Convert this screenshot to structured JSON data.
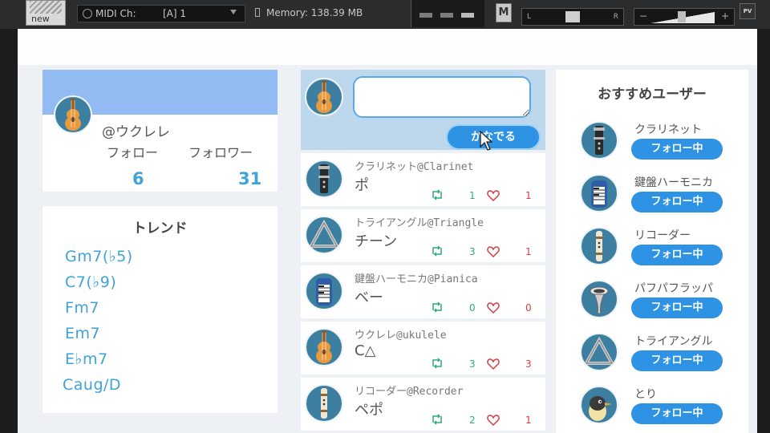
{
  "host": {
    "logo_text": "new",
    "midi_label": "MIDI Ch:",
    "midi_value": "[A] 1",
    "memory": "Memory: 138.39 MB",
    "mute_label": "M",
    "pan_left": "L",
    "pan_right": "R",
    "vol_minus": "−",
    "vol_plus": "+",
    "pv_label": "PV"
  },
  "profile": {
    "handle": "@ウクレレ",
    "follow_label": "フォロー",
    "follower_label": "フォロワー",
    "follow_count": "6",
    "follower_count": "31",
    "avatar_icon": "ukulele-icon",
    "banner_color": "#92baf3"
  },
  "trend": {
    "title": "トレンド",
    "items": [
      "Gm7(♭5)",
      "C7(♭9)",
      "Fm7",
      "Em7",
      "E♭m7",
      "Caug/D"
    ]
  },
  "compose": {
    "placeholder": "",
    "send_label": "かなでる",
    "avatar_icon": "ukulele-icon"
  },
  "posts": [
    {
      "author": "クラリネット@Clarinet",
      "body": "ポ",
      "retweets": "1",
      "likes": "1",
      "icon": "clarinet-icon"
    },
    {
      "author": "トライアングル@Triangle",
      "body": "チーン",
      "retweets": "3",
      "likes": "1",
      "icon": "triangle-icon"
    },
    {
      "author": "鍵盤ハーモニカ@Pianica",
      "body": "ベー",
      "retweets": "0",
      "likes": "0",
      "icon": "pianica-icon"
    },
    {
      "author": "ウクレレ@ukulele",
      "body": "C△",
      "retweets": "3",
      "likes": "3",
      "icon": "ukulele-icon"
    },
    {
      "author": "リコーダー@Recorder",
      "body": "ペポ",
      "retweets": "2",
      "likes": "1",
      "icon": "recorder-icon"
    }
  ],
  "recommend": {
    "title": "おすすめユーザー",
    "users": [
      {
        "name": "クラリネット",
        "button": "フォロー中",
        "icon": "clarinet-icon"
      },
      {
        "name": "鍵盤ハーモニカ",
        "button": "フォロー中",
        "icon": "pianica-icon"
      },
      {
        "name": "リコーダー",
        "button": "フォロー中",
        "icon": "recorder-icon"
      },
      {
        "name": "パフパフラッパ",
        "button": "フォロー中",
        "icon": "horn-icon"
      },
      {
        "name": "トライアングル",
        "button": "フォロー中",
        "icon": "triangle-icon"
      },
      {
        "name": "とり",
        "button": "フォロー中",
        "icon": "bird-icon"
      }
    ]
  },
  "colors": {
    "accent": "#2f93e5",
    "count_blue": "#3fa3d9",
    "retweet_green": "#2eaa7a",
    "like_red": "#d83b43",
    "avatar_bg": "#3d7fa1"
  }
}
